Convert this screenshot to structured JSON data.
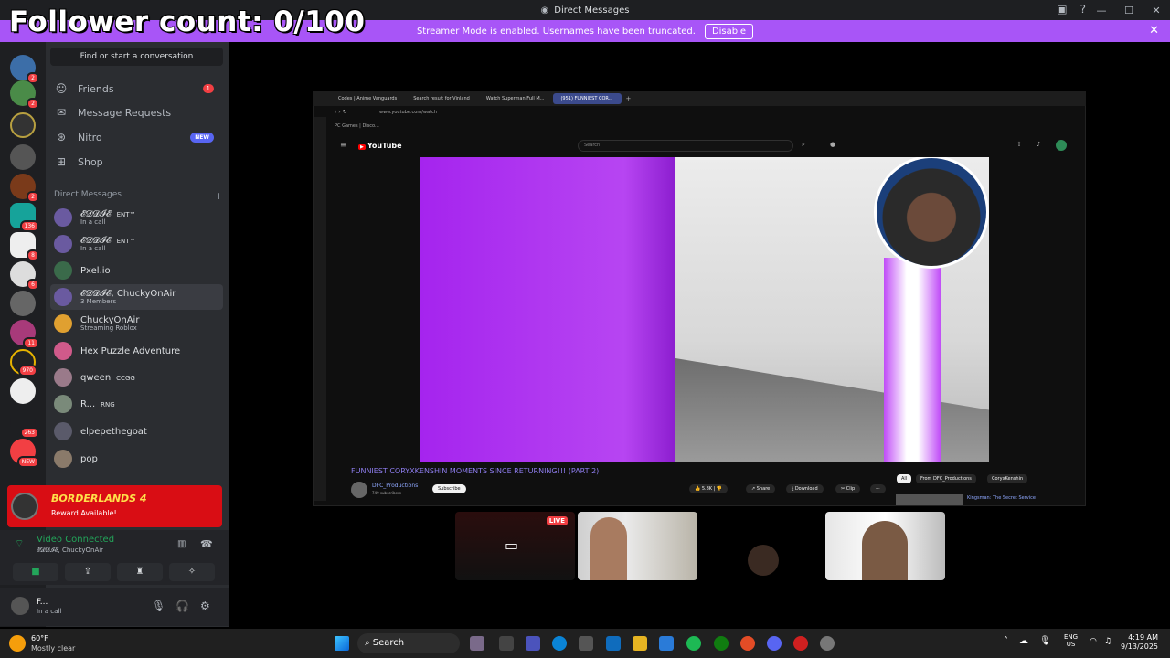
{
  "overlay": {
    "follower_text": "Follower count: 0/100"
  },
  "titlebar": {
    "title": "Direct Messages"
  },
  "banner": {
    "message": "Streamer Mode is enabled. Usernames have been truncated.",
    "disable_label": "Disable"
  },
  "rail_badges": [
    "2",
    "2",
    "2",
    "136",
    "8",
    "6",
    "11",
    "970",
    "263",
    "NEW"
  ],
  "sidebar": {
    "find_placeholder": "Find or start a conversation",
    "nav": [
      {
        "label": "Friends",
        "badge": "1"
      },
      {
        "label": "Message Requests"
      },
      {
        "label": "Nitro",
        "badge": "NEW"
      },
      {
        "label": "Shop"
      }
    ],
    "dm_header": "Direct Messages",
    "dms": [
      {
        "name": "𝓔𝓓𝓓𝓘𝓔",
        "tag": "ENT™",
        "sub": "In a call"
      },
      {
        "name": "𝓔𝓓𝓓𝓘𝓔",
        "tag": "ENT™",
        "sub": "In a call"
      },
      {
        "name": "Pxel.io",
        "tag": "",
        "sub": ""
      },
      {
        "name": "𝓔𝓓𝓓𝓘𝓔, ChuckyOnAir",
        "tag": "",
        "sub": "3 Members"
      },
      {
        "name": "ChuckyOnAir",
        "tag": "",
        "sub": "Streaming Roblox"
      },
      {
        "name": "Hex Puzzle Adventure",
        "tag": "",
        "sub": ""
      },
      {
        "name": "qween",
        "tag": "CCGG",
        "sub": ""
      },
      {
        "name": "R...",
        "tag": "RNG",
        "sub": ""
      },
      {
        "name": "elpepethegoat",
        "tag": "",
        "sub": ""
      },
      {
        "name": "pop",
        "tag": "",
        "sub": ""
      }
    ]
  },
  "reward": {
    "title": "BORDERLANDS 4",
    "subtitle": "Reward Available!"
  },
  "voice": {
    "status": "Video Connected",
    "channel": "𝓔𝓓𝓓𝓘𝓔, ChuckyOnAir"
  },
  "user": {
    "name": "F...",
    "status": "In a call"
  },
  "browser": {
    "tabs": [
      "Codes | Anime Vanguards",
      "Search result for Vinland",
      "Watch Superman Full M...",
      "(951) FUNNIEST COR..."
    ],
    "url": "www.youtube.com/watch",
    "bookmark": "PC Games | Disco...",
    "yt_logo": "YouTube",
    "search_placeholder": "Search",
    "video_title": "FUNNIEST CORYXKENSHIN MOMENTS SINCE RETURNING!!! (PART 2)",
    "channel_name": "DFC_Productions",
    "channel_subs": "749 subscribers",
    "subscribe_label": "Subscribe",
    "likes": "5.8K",
    "share_label": "Share",
    "download_label": "Download",
    "clip_label": "Clip",
    "chips": [
      "All",
      "From DFC_Productions",
      "CoryxKenshin"
    ],
    "rec_title": "Kingsman: The Secret Service"
  },
  "tiles": {
    "live_label": "LIVE"
  },
  "taskbar": {
    "temp": "60°F",
    "weather": "Mostly clear",
    "search_label": "Search",
    "lang1": "ENG",
    "lang2": "US",
    "time": "4:19 AM",
    "date": "9/13/2025"
  }
}
